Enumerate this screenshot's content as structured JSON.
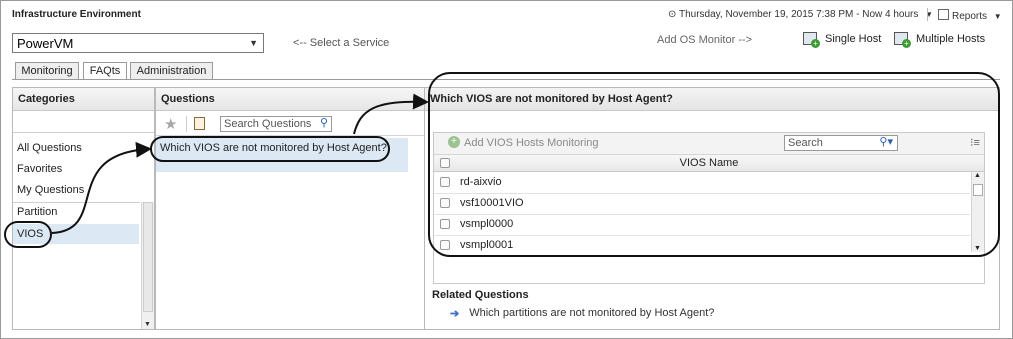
{
  "header": {
    "env_title": "Infrastructure Environment",
    "time_range": "Thursday, November 19, 2015 7:38 PM - Now 4 hours",
    "reports_label": "Reports"
  },
  "service": {
    "selected": "PowerVM",
    "hint": "<-- Select a Service"
  },
  "os_monitor": {
    "label": "Add OS Monitor -->",
    "single_host": "Single Host",
    "multiple_hosts": "Multiple Hosts"
  },
  "tabs": [
    {
      "label": "Monitoring"
    },
    {
      "label": "FAQts"
    },
    {
      "label": "Administration"
    }
  ],
  "categories": {
    "title": "Categories",
    "items": [
      "All Questions",
      "Favorites",
      "My Questions",
      "Partition",
      "VIOS"
    ]
  },
  "questions": {
    "title": "Questions",
    "search_placeholder": "Search Questions",
    "items": [
      "Which VIOS are not monitored by Host Agent?"
    ]
  },
  "answer": {
    "title": "Which VIOS are not monitored by Host Agent?",
    "add_button": "Add VIOS Hosts Monitoring",
    "search_placeholder": "Search",
    "column": "VIOS Name",
    "rows": [
      "rd-aixvio",
      "vsf10001VIO",
      "vsmpl0000",
      "vsmpl0001"
    ]
  },
  "related": {
    "title": "Related Questions",
    "items": [
      "Which partitions are not monitored by Host Agent?"
    ]
  },
  "colors": {
    "selected_row": "#dde8f5",
    "accent_green": "#3d9b35",
    "link_arrow": "#3a6fc4"
  }
}
